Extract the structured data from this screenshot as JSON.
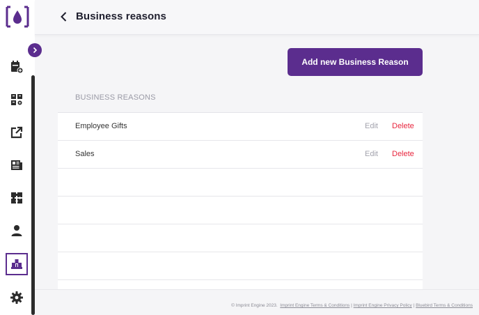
{
  "header": {
    "title": "Business reasons"
  },
  "actions": {
    "add_label": "Add new Business Reason"
  },
  "section": {
    "label": "BUSINESS REASONS"
  },
  "rows": [
    {
      "name": "Employee Gifts",
      "edit": "Edit",
      "delete": "Delete"
    },
    {
      "name": "Sales",
      "edit": "Edit",
      "delete": "Delete"
    }
  ],
  "footer": {
    "copyright": "© Imprint Engine 2023.",
    "terms": "Imprint Engine Terms & Conditions",
    "privacy": "Imprint Engine Privacy Policy",
    "bluebird": "Bluebird Terms & Conditions",
    "sep": "|"
  },
  "sidebar": {
    "items": [
      {
        "icon": "calendar-plus-icon"
      },
      {
        "icon": "grid-boxes-icon"
      },
      {
        "icon": "external-link-icon"
      },
      {
        "icon": "newspaper-icon"
      },
      {
        "icon": "puzzle-icon"
      },
      {
        "icon": "user-icon"
      },
      {
        "icon": "warehouse-icon",
        "active": true
      },
      {
        "icon": "gear-icon"
      }
    ]
  },
  "colors": {
    "brand": "#5b2d8e",
    "danger": "#e8273f",
    "muted": "#a3a3ad"
  }
}
